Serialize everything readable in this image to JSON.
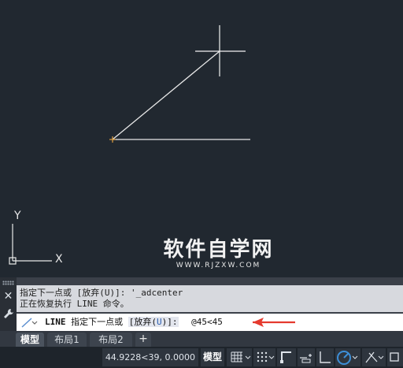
{
  "viewport": {
    "ucs_y_label": "Y",
    "ucs_x_label": "X",
    "colors": {
      "background": "#212830",
      "geometry": "#e8e8e8",
      "start_point": "#e0a040"
    }
  },
  "watermark": {
    "main": "软件自学网",
    "sub": "WWW.RJZXW.COM"
  },
  "command_panel": {
    "history": [
      "指定下一点或 [放弃(U)]: '_adcenter",
      "正在恢复执行 LINE 命令。"
    ],
    "prompt": {
      "command": "LINE",
      "text": "指定下一点或",
      "option_open": "[放弃(",
      "option_key": "U",
      "option_close": ")]:",
      "typed_value": "@45<45"
    },
    "close_icon": "close-icon",
    "settings_icon": "wrench-icon"
  },
  "layout_tabs": {
    "tabs": [
      {
        "label": "模型",
        "active": true
      },
      {
        "label": "布局1",
        "active": false
      },
      {
        "label": "布局2",
        "active": false
      }
    ],
    "add_label": "+"
  },
  "status_bar": {
    "coordinates": "44.9228<39, 0.0000",
    "model_label": "模型",
    "icons": [
      "grid-icon",
      "snap-mode-icon",
      "infer-constraints-icon",
      "ortho-icon",
      "polar-tracking-icon",
      "isodraft-icon"
    ],
    "accent": "#3d8fd8"
  }
}
